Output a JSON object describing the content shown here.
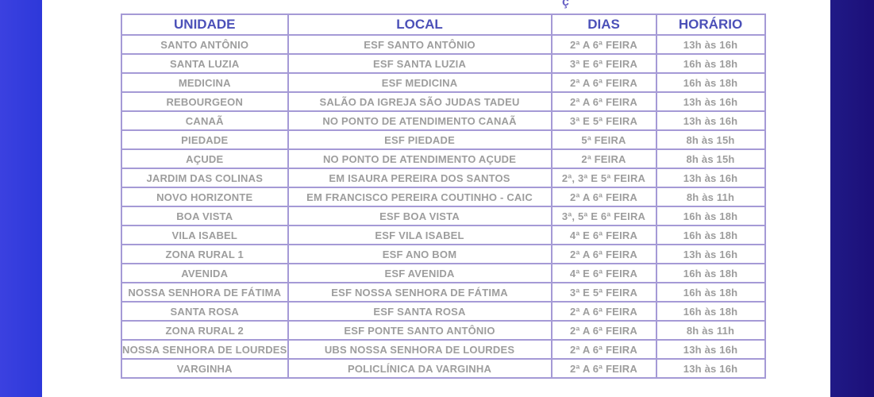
{
  "colors": {
    "accent": "#4b50b8",
    "border": "#a59ad6",
    "cell_text": "#9d9d9d",
    "background_left": "#3b41e0",
    "background_right": "#1c0f78"
  },
  "table": {
    "headers": [
      "UNIDADE",
      "LOCAL",
      "DIAS",
      "HORÁRIO"
    ],
    "rows": [
      [
        "SANTO ANTÔNIO",
        "ESF SANTO ANTÔNIO",
        "2ª A 6ª FEIRA",
        "13h às 16h"
      ],
      [
        "SANTA LUZIA",
        "ESF SANTA LUZIA",
        "3ª E 6ª FEIRA",
        "16h às 18h"
      ],
      [
        "MEDICINA",
        "ESF MEDICINA",
        "2ª A 6ª FEIRA",
        "16h às 18h"
      ],
      [
        "REBOURGEON",
        "SALÃO DA IGREJA SÃO JUDAS TADEU",
        "2ª A 6ª FEIRA",
        "13h às 16h"
      ],
      [
        "CANAÃ",
        "NO PONTO DE ATENDIMENTO CANAÃ",
        "3ª E 5ª FEIRA",
        "13h às 16h"
      ],
      [
        "PIEDADE",
        "ESF PIEDADE",
        "5ª FEIRA",
        "8h às 15h"
      ],
      [
        "AÇUDE",
        "NO PONTO DE ATENDIMENTO AÇUDE",
        "2ª FEIRA",
        "8h às 15h"
      ],
      [
        "JARDIM DAS COLINAS",
        "EM ISAURA PEREIRA DOS SANTOS",
        "2ª, 3ª E 5ª FEIRA",
        "13h às 16h"
      ],
      [
        "NOVO HORIZONTE",
        "EM FRANCISCO PEREIRA COUTINHO - CAIC",
        "2ª A 6ª FEIRA",
        "8h às 11h"
      ],
      [
        "BOA VISTA",
        "ESF BOA VISTA",
        "3ª, 5ª E 6ª FEIRA",
        "16h às 18h"
      ],
      [
        "VILA ISABEL",
        "ESF VILA ISABEL",
        "4ª E 6ª FEIRA",
        "16h às 18h"
      ],
      [
        "ZONA RURAL 1",
        "ESF ANO BOM",
        "2ª A 6ª FEIRA",
        "13h às 16h"
      ],
      [
        "AVENIDA",
        "ESF AVENIDA",
        "4ª E 6ª FEIRA",
        "16h às 18h"
      ],
      [
        "NOSSA SENHORA DE FÁTIMA",
        "ESF NOSSA SENHORA DE FÁTIMA",
        "3ª E 5ª FEIRA",
        "16h às 18h"
      ],
      [
        "SANTA ROSA",
        "ESF SANTA ROSA",
        "2ª A 6ª FEIRA",
        "16h às 18h"
      ],
      [
        "ZONA RURAL 2",
        "ESF PONTE SANTO ANTÔNIO",
        "2ª A 6ª FEIRA",
        "8h às 11h"
      ],
      [
        "NOSSA SENHORA DE LOURDES",
        "UBS NOSSA SENHORA DE LOURDES",
        "2ª A 6ª FEIRA",
        "13h às 16h"
      ],
      [
        "VARGINHA",
        "POLICLÍNICA DA VARGINHA",
        "2ª A 6ª FEIRA",
        "13h às 16h"
      ]
    ]
  }
}
